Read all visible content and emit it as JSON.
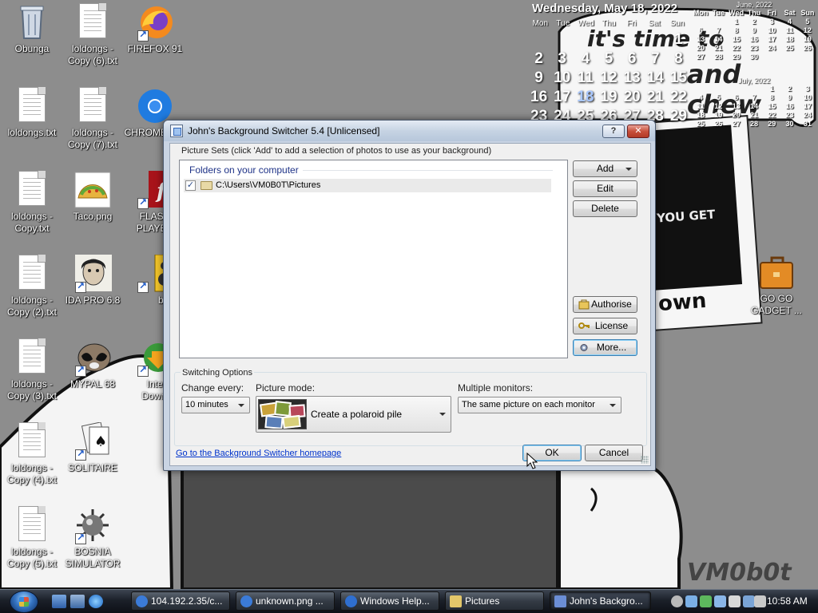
{
  "calendar": {
    "date_heading": "Wednesday, May 18, 2022",
    "weekdays": [
      "Mon",
      "Tue",
      "Wed",
      "Thu",
      "Fri",
      "Sat",
      "Sun"
    ],
    "big_days": [
      "",
      "",
      "",
      "",
      "",
      "",
      "1",
      "2",
      "3",
      "4",
      "5",
      "6",
      "7",
      "8",
      "9",
      "10",
      "11",
      "12",
      "13",
      "14",
      "15",
      "16",
      "17",
      "18",
      "19",
      "20",
      "21",
      "22",
      "23",
      "24",
      "25",
      "26",
      "27",
      "28",
      "29"
    ],
    "today": "18",
    "mini_june": {
      "title": "June, 2022",
      "days": [
        "Mon",
        "Tue",
        "Wed",
        "Thu",
        "Fri",
        "Sat",
        "Sun",
        "",
        "",
        "1",
        "2",
        "3",
        "4",
        "5",
        "6",
        "7",
        "8",
        "9",
        "10",
        "11",
        "12",
        "13",
        "14",
        "15",
        "16",
        "17",
        "18",
        "19",
        "20",
        "21",
        "22",
        "23",
        "24",
        "25",
        "26",
        "27",
        "28",
        "29",
        "30",
        "",
        "",
        ""
      ]
    },
    "mini_july": {
      "title": "July, 2022",
      "days": [
        "",
        "",
        "",
        "",
        "1",
        "2",
        "3",
        "4",
        "5",
        "6",
        "7",
        "8",
        "9",
        "10",
        "11",
        "12",
        "13",
        "14",
        "15",
        "16",
        "17",
        "18",
        "19",
        "20",
        "21",
        "22",
        "23",
        "24",
        "25",
        "26",
        "27",
        "28",
        "29",
        "30",
        "31"
      ]
    }
  },
  "wallpaper": {
    "line1": "it's time to",
    "line2": "and chew",
    "poster_text": "YOU GET",
    "poster_text2": "own",
    "signature": "VM0b0t"
  },
  "desktop_icons": [
    {
      "label": "Obunga",
      "kind": "recycle"
    },
    {
      "label": "loldongs - Copy (6).txt",
      "kind": "txt"
    },
    {
      "label": "FIREFOX 91",
      "kind": "firefox"
    },
    {
      "label": "loldongs.txt",
      "kind": "txt"
    },
    {
      "label": "loldongs - Copy (7).txt",
      "kind": "txt"
    },
    {
      "label": "CHROME 101",
      "kind": "chrome"
    },
    {
      "label": "loldongs - Copy.txt",
      "kind": "txt"
    },
    {
      "label": "Taco.png",
      "kind": "taco"
    },
    {
      "label": "FLASH PLAYER",
      "kind": "flash"
    },
    {
      "label": "loldongs - Copy (2).txt",
      "kind": "txt"
    },
    {
      "label": "IDA PRO 6.8",
      "kind": "ida"
    },
    {
      "label": "butt",
      "kind": "speaker"
    },
    {
      "label": "loldongs - Copy (3).txt",
      "kind": "txt"
    },
    {
      "label": "MYPAL 68",
      "kind": "raccoon"
    },
    {
      "label": "Internet Download",
      "kind": "idm"
    },
    {
      "label": "loldongs - Copy (4).txt",
      "kind": "txt"
    },
    {
      "label": "SOLITAIRE",
      "kind": "cards"
    },
    {
      "label": "loldongs - Copy (5).txt",
      "kind": "txt"
    },
    {
      "label": "BOSNIA SIMULATOR",
      "kind": "mine"
    },
    {
      "label": "GO GO GADGET ...",
      "kind": "briefcase"
    }
  ],
  "dialog": {
    "title": "John's Background Switcher 5.4 [Unlicensed]",
    "help_label": "?",
    "close_label": "✕",
    "picture_sets_label": "Picture Sets (click 'Add' to add a selection of photos to use as your background)",
    "folders_header": "Folders on your computer",
    "folder_path": "C:\\Users\\VM0B0T\\Pictures",
    "folder_checked": "✓",
    "buttons": {
      "add": "Add",
      "edit": "Edit",
      "delete": "Delete",
      "authorise": "Authorise",
      "license": "License",
      "more": "More...",
      "ok": "OK",
      "cancel": "Cancel"
    },
    "switching_options_label": "Switching Options",
    "change_every_label": "Change every:",
    "change_every_value": "10 minutes",
    "picture_mode_label": "Picture mode:",
    "picture_mode_value": "Create a polaroid pile",
    "multiple_monitors_label": "Multiple monitors:",
    "multiple_monitors_value": "The same picture on each monitor",
    "homepage_link": "Go to the Background Switcher homepage"
  },
  "taskbar": {
    "items": [
      {
        "label": "104.192.2.35/c...",
        "color": "#3b7bd8"
      },
      {
        "label": "unknown.png ...",
        "color": "#3b7bd8"
      },
      {
        "label": "Windows Help...",
        "color": "#2f6fd0"
      },
      {
        "label": "Pictures",
        "color": "#e3c76a"
      },
      {
        "label": "John's Backgro...",
        "color": "#6b8ed6"
      }
    ],
    "clock": "10:58 AM"
  },
  "colors": {
    "link": "#0033cc",
    "title_gradient": "#c6d3e3",
    "taskbar": "#1b2029"
  }
}
